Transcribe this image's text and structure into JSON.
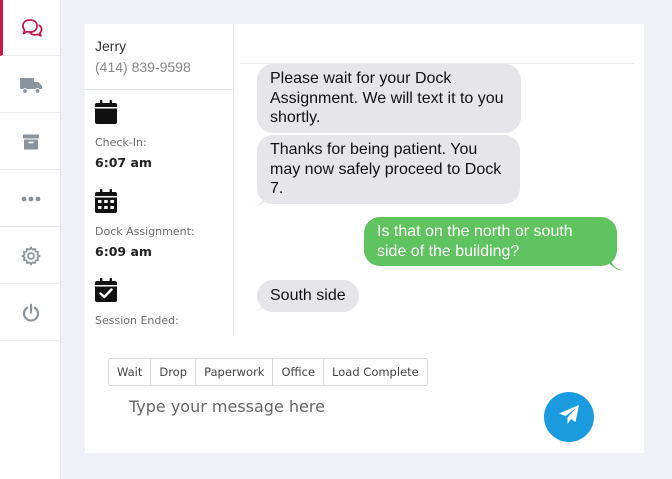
{
  "nav": {
    "items": [
      {
        "icon": "chat-icon",
        "active": true
      },
      {
        "icon": "truck-icon",
        "active": false
      },
      {
        "icon": "archive-icon",
        "active": false
      },
      {
        "icon": "more-icon",
        "active": false
      },
      {
        "icon": "gear-icon",
        "active": false
      },
      {
        "icon": "power-icon",
        "active": false
      }
    ],
    "accent": "#c8174a"
  },
  "contact": {
    "name": "Jerry",
    "phone": "(414) 839-9598"
  },
  "timeline": [
    {
      "icon": "calendar-icon",
      "label": "Check-In:",
      "value": "6:07 am"
    },
    {
      "icon": "calendar-grid-icon",
      "label": "Dock Assignment:",
      "value": "6:09 am"
    },
    {
      "icon": "calendar-check-icon",
      "label": "Session Ended:",
      "value": ""
    }
  ],
  "messages": [
    {
      "direction": "in",
      "text": "Please wait for your Dock Assignment.  We will text it to you shortly."
    },
    {
      "direction": "in",
      "text": "Thanks for being patient. You may now safely proceed to Dock 7."
    },
    {
      "direction": "out",
      "text": "Is that on the north or south side of the building?"
    },
    {
      "direction": "in",
      "text": "South side"
    }
  ],
  "quick_replies": [
    "Wait",
    "Drop",
    "Paperwork",
    "Office",
    "Load Complete"
  ],
  "composer": {
    "placeholder": "Type your message here",
    "value": ""
  },
  "colors": {
    "incoming_bubble": "#e5e5ea",
    "outgoing_bubble": "#5fc35f",
    "send_button": "#1a9be0"
  }
}
